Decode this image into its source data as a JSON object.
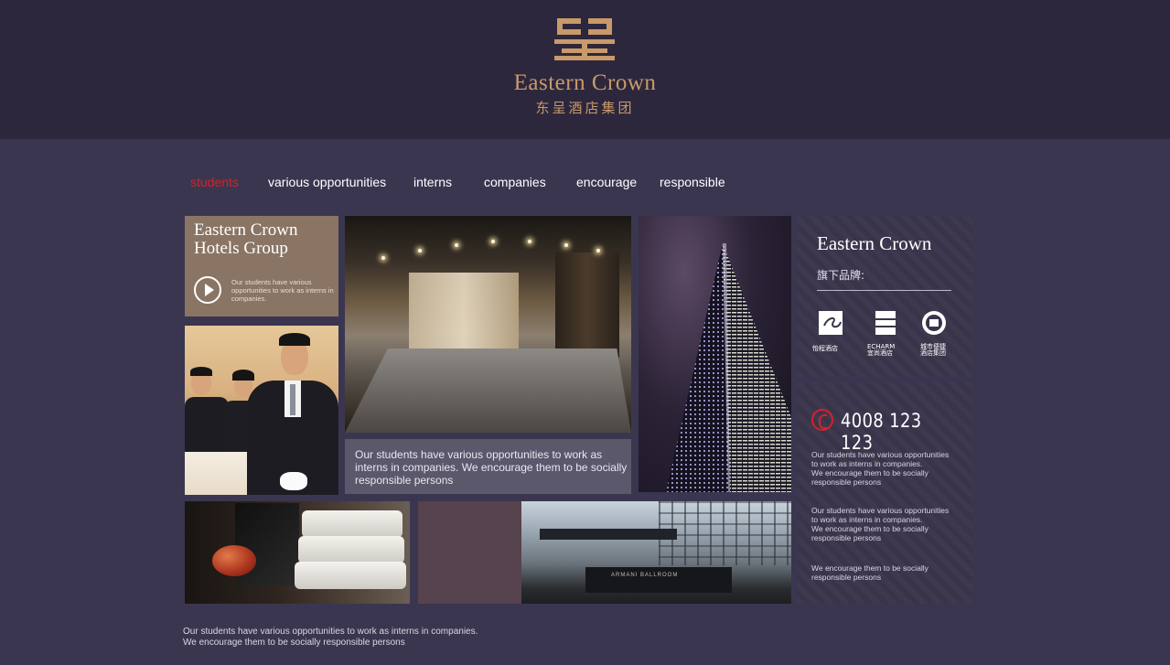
{
  "header": {
    "logo_name": "Eastern Crown",
    "logo_cn": "东呈酒店集团",
    "brand_color": "#c89a6a"
  },
  "nav": {
    "items": [
      {
        "label": "students",
        "active": true
      },
      {
        "label": "various opportunities",
        "active": false
      },
      {
        "label": "interns",
        "active": false
      },
      {
        "label": "companies",
        "active": false
      },
      {
        "label": "encourage",
        "active": false
      },
      {
        "label": "responsible",
        "active": false
      }
    ],
    "active_color": "#d2232a"
  },
  "brand_tile": {
    "title_line1": "Eastern Crown",
    "title_line2": "Hotels Group",
    "text": "Our students have various opportunities to work as interns in companies.",
    "play_icon": "play-icon"
  },
  "caption": {
    "text": "Our students have various opportunities to work as interns in companies. We encourage them to be socially responsible persons"
  },
  "brands_panel": {
    "title": "Eastern Crown",
    "subtitle": "旗下品牌:",
    "brands": [
      {
        "caption": "怡程酒店",
        "icon": "yicheng-logo"
      },
      {
        "caption": "ECHARM",
        "caption2": "宜尚酒店",
        "icon": "echarm-logo"
      },
      {
        "caption": "城市便捷",
        "caption2": "酒店集团",
        "icon": "city-comfort-logo"
      }
    ]
  },
  "contact_panel": {
    "phone": "4008 123 123",
    "phone_icon": "phone-icon",
    "para1_line1": "Our students have various opportunities",
    "para1_line2": "to work as interns in companies.",
    "para1_line3": "We encourage them to be socially",
    "para1_line4": "responsible persons",
    "para2_line1": "Our students have various opportunities",
    "para2_line2": "to work as interns in companies.",
    "para2_line3": "We encourage them to be socially",
    "para2_line4": "responsible persons",
    "para3_line1": "We encourage them to be socially",
    "para3_line2": "responsible persons",
    "accent_color": "#d2232a"
  },
  "photos": {
    "building_sign": "ARMANI BALLROOM"
  },
  "footer": {
    "line1": "Our students have various opportunities to work as interns in companies.",
    "line2": "We encourage them to be socially responsible persons"
  }
}
